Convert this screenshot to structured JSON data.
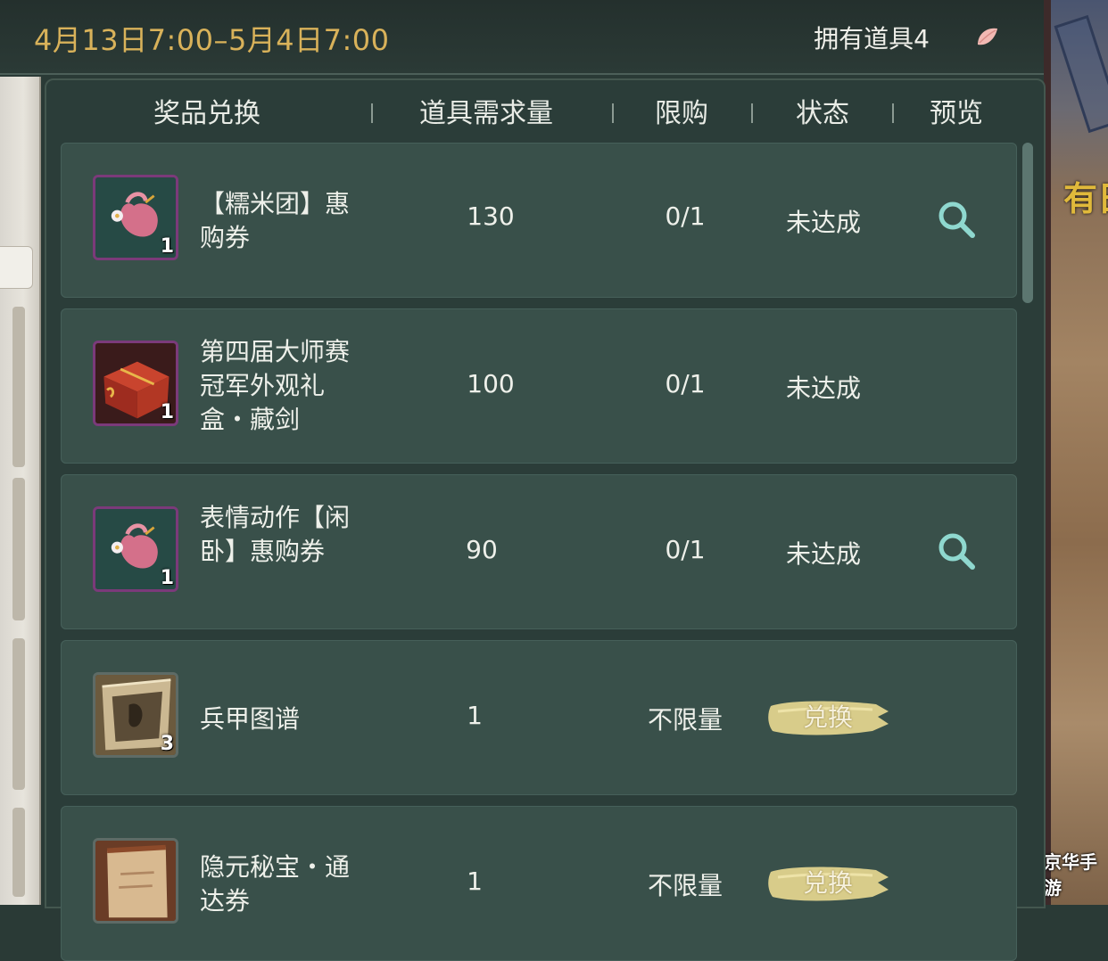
{
  "top_bar": {
    "date_range": "4月13日7:00–5月4日7:00",
    "owned_count": "拥有道具4"
  },
  "columns": {
    "reward": "奖品兑换",
    "required": "道具需求量",
    "limit": "限购",
    "status": "状态",
    "preview": "预览"
  },
  "rows": [
    {
      "name": "【糯米团】惠购券",
      "count": "1",
      "required": "130",
      "limit": "0/1",
      "status": "未达成",
      "preview": true,
      "icon": "pink-pouch-icon"
    },
    {
      "name": "第四届大师赛冠军外观礼盒・藏剑",
      "count": "1",
      "required": "100",
      "limit": "0/1",
      "status": "未达成",
      "preview": false,
      "icon": "red-gift-box-icon"
    },
    {
      "name": "表情动作【闲卧】惠购券",
      "count": "1",
      "required": "90",
      "limit": "0/1",
      "status": "未达成",
      "preview": true,
      "icon": "pink-pouch-icon"
    },
    {
      "name": "兵甲图谱",
      "count": "3",
      "required": "1",
      "limit": "不限量",
      "action": "兑换",
      "icon": "scroll-map-icon"
    },
    {
      "name": "隐元秘宝・通达券",
      "count": "",
      "required": "1",
      "limit": "不限量",
      "action": "兑换",
      "icon": "paper-scroll-icon"
    }
  ],
  "side_art": {
    "glyph": "有日"
  },
  "watermark": "京华手游",
  "colors": {
    "accent_gold": "#d9b25a",
    "row_bg": "#39504a",
    "panel_bg": "#2b3d39",
    "button_gold": "#d8cc8a"
  }
}
